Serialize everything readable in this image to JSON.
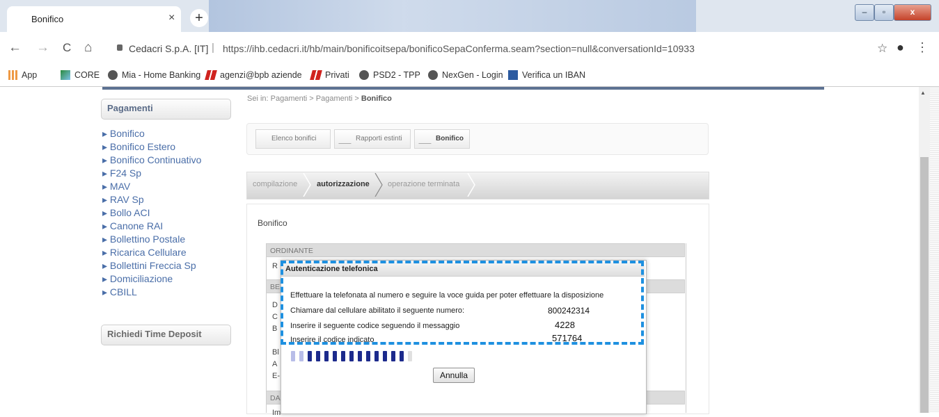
{
  "browser": {
    "tab_title": "Bonifico",
    "tab_close": "×",
    "new_tab": "+",
    "back": "←",
    "forward": "→",
    "reload": "C",
    "home": "⌂",
    "site_name": "Cedacri S.p.A. [IT]",
    "separator": "|",
    "url": "https://ihb.cedacri.it/hb/main/bonificoitsepa/bonificoSepaConferma.seam?section=null&conversationId=10933",
    "star": "☆",
    "account": "●",
    "menu": "⋮",
    "window_controls": {
      "minimize": "–",
      "maximize": "▫",
      "close": "x"
    }
  },
  "bookmarks": [
    {
      "label": "App",
      "icon": "apps-grid-icon"
    },
    {
      "label": "CORE",
      "icon": "image-icon"
    },
    {
      "label": "Mia - Home Banking",
      "icon": "globe-icon"
    },
    {
      "label": "agenzi@bpb aziende",
      "icon": "bank-logo-icon"
    },
    {
      "label": "Privati",
      "icon": "bank-logo-icon"
    },
    {
      "label": "PSD2 - TPP",
      "icon": "globe-icon"
    },
    {
      "label": "NexGen - Login",
      "icon": "globe-icon"
    },
    {
      "label": "Verifica un IBAN",
      "icon": "iban-icon"
    }
  ],
  "sidebar": {
    "title": "Pagamenti",
    "items": [
      "Bonifico",
      "Bonifico Estero",
      "Bonifico Continuativo",
      "F24 Sp",
      "MAV",
      "RAV Sp",
      "Bollo ACI",
      "Canone RAI",
      "Bollettino Postale",
      "Ricarica Cellulare",
      "Bollettini Freccia Sp",
      "Domiciliazione",
      "CBILL"
    ],
    "time_deposit": "Richiedi Time Deposit"
  },
  "breadcrumb": {
    "prefix": "Sei in: Pagamenti > Pagamenti >",
    "current": "Bonifico"
  },
  "toolbar": {
    "list": "Elenco bonifici",
    "reports": "Rapporti estinti",
    "transfer": "Bonifico"
  },
  "steps": [
    "compilazione",
    "autorizzazione",
    "operazione terminata"
  ],
  "content": {
    "title": "Bonifico",
    "sections": [
      "ORDINANTE",
      "BE",
      "DA"
    ],
    "fragments": [
      "R",
      "D",
      "C",
      "B",
      "Bl",
      "A",
      "E-",
      "Im"
    ]
  },
  "dialog": {
    "title": "Autenticazione telefonica",
    "instruction": "Effettuare la telefonata al numero e seguire la voce guida per poter effettuare la disposizione",
    "row1_label": "Chiamare dal cellulare abilitato il seguente numero:",
    "row1_value": "800242314",
    "row2_label": "Inserire il seguente codice seguendo il messaggio",
    "row2_value": "4228",
    "row3_label": "Inserire il codice indicato",
    "row3_value": "571764",
    "progress": 0.93,
    "cancel_label": "Annulla"
  },
  "colors": {
    "highlight": "#1e90e0",
    "link": "#4a6ea8",
    "progress": "#1c2a8c"
  }
}
